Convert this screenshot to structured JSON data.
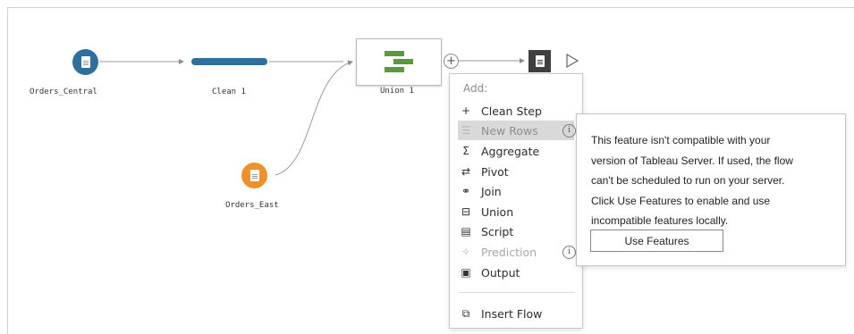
{
  "colors": {
    "central_node": "#2f6f9e",
    "east_node": "#f0902a",
    "clean_step": "#2f6f9e",
    "union_icon": "#5a9a3c",
    "output_node": "#404040"
  },
  "flow": {
    "orders_central": {
      "label": "Orders_Central",
      "icon": "document-icon"
    },
    "clean": {
      "label": "Clean 1"
    },
    "union": {
      "label": "Union 1",
      "icon": "union-icon"
    },
    "orders_east": {
      "label": "Orders_East",
      "icon": "document-icon"
    },
    "add_step_icon": "plus-circle-icon",
    "output_icon": "document-icon",
    "run_icon": "play-triangle-icon"
  },
  "menu": {
    "header": "Add:",
    "items": [
      {
        "icon": "plus-icon",
        "label": "Clean Step",
        "state": "enabled"
      },
      {
        "icon": "new-rows-icon",
        "label": "New Rows",
        "state": "disabled-hover",
        "info": "i"
      },
      {
        "icon": "sigma-icon",
        "label": "Aggregate",
        "state": "enabled"
      },
      {
        "icon": "pivot-icon",
        "label": "Pivot",
        "state": "enabled"
      },
      {
        "icon": "join-icon",
        "label": "Join",
        "state": "enabled"
      },
      {
        "icon": "union-icon",
        "label": "Union",
        "state": "enabled"
      },
      {
        "icon": "script-icon",
        "label": "Script",
        "state": "enabled"
      },
      {
        "icon": "prediction-icon",
        "label": "Prediction",
        "state": "disabled",
        "info": "i"
      },
      {
        "icon": "output-icon",
        "label": "Output",
        "state": "enabled"
      },
      {
        "icon": "insert-flow-icon",
        "label": "Insert Flow",
        "state": "enabled"
      }
    ]
  },
  "tooltip": {
    "lines": [
      "This feature isn't compatible with your",
      "version of Tableau Server. If used, the flow",
      "can't be scheduled to run on your server.",
      "Click Use Features to enable and use",
      "incompatible features locally."
    ],
    "button_label": "Use Features"
  }
}
